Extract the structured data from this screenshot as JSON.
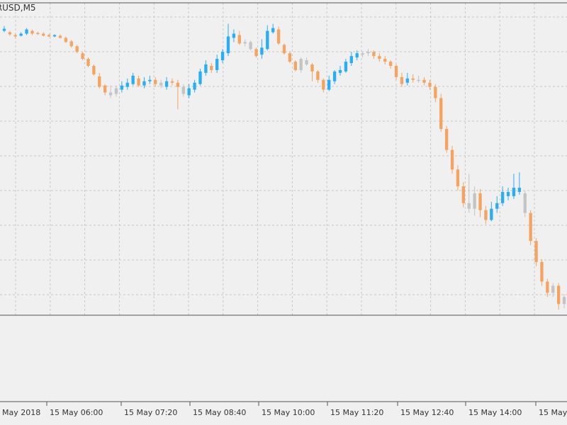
{
  "window": {
    "symbol_label": "URUSD,M5"
  },
  "colors": {
    "background": "#f0f0f0",
    "grid": "#c8c8c8",
    "axis": "#555555",
    "bull": "#29aef5",
    "bear": "#f4a460",
    "neutral": "#c4c4c4"
  },
  "chart_data": {
    "type": "candlestick",
    "title": "",
    "xlabel": "",
    "ylabel": "",
    "x_tick_labels": [
      "May 2018",
      "15 May 06:00",
      "15 May 07:20",
      "15 May 08:40",
      "15 May 10:00",
      "15 May 11:20",
      "15 May 12:40",
      "15 May 14:00",
      "15 May"
    ],
    "grid": true,
    "series": [
      {
        "values": [
          [
            40,
            37,
            33,
            42,
            "bull"
          ],
          [
            45,
            42,
            40,
            47,
            "bear"
          ],
          [
            46,
            48,
            44,
            50,
            "bear"
          ],
          [
            47,
            44,
            42,
            48,
            "bull"
          ],
          [
            44,
            38,
            36,
            46,
            "bull"
          ],
          [
            40,
            44,
            38,
            46,
            "bear"
          ],
          [
            43,
            44,
            41,
            46,
            "bear"
          ],
          [
            44,
            47,
            42,
            48,
            "bear"
          ],
          [
            46,
            48,
            44,
            49,
            "bear"
          ],
          [
            48,
            46,
            45,
            49,
            "bull"
          ],
          [
            47,
            50,
            45,
            51,
            "bear"
          ],
          [
            50,
            56,
            48,
            57,
            "bear"
          ],
          [
            55,
            62,
            53,
            64,
            "bear"
          ],
          [
            62,
            70,
            60,
            72,
            "bear"
          ],
          [
            72,
            80,
            70,
            82,
            "bear"
          ],
          [
            80,
            90,
            78,
            92,
            "bear"
          ],
          [
            90,
            102,
            88,
            104,
            "bear"
          ],
          [
            105,
            120,
            100,
            122,
            "bear"
          ],
          [
            118,
            128,
            116,
            132,
            "bear"
          ],
          [
            128,
            132,
            118,
            136,
            "neutral"
          ],
          [
            130,
            122,
            118,
            134,
            "neutral"
          ],
          [
            124,
            118,
            112,
            128,
            "bull"
          ],
          [
            120,
            114,
            108,
            124,
            "bull"
          ],
          [
            116,
            104,
            100,
            118,
            "bull"
          ],
          [
            108,
            118,
            104,
            120,
            "bear"
          ],
          [
            118,
            112,
            106,
            122,
            "bull"
          ],
          [
            112,
            110,
            104,
            116,
            "bull"
          ],
          [
            110,
            116,
            106,
            120,
            "bear"
          ],
          [
            114,
            118,
            110,
            122,
            "neutral"
          ],
          [
            120,
            112,
            106,
            124,
            "bull"
          ],
          [
            112,
            114,
            108,
            118,
            "bear"
          ],
          [
            114,
            120,
            110,
            152,
            "bear"
          ],
          [
            120,
            130,
            116,
            134,
            "neutral"
          ],
          [
            132,
            122,
            116,
            136,
            "bull"
          ],
          [
            124,
            114,
            110,
            128,
            "bull"
          ],
          [
            116,
            98,
            94,
            118,
            "bull"
          ],
          [
            100,
            88,
            82,
            104,
            "bull"
          ],
          [
            90,
            96,
            86,
            100,
            "bear"
          ],
          [
            96,
            80,
            74,
            100,
            "bull"
          ],
          [
            82,
            70,
            66,
            86,
            "bull"
          ],
          [
            72,
            48,
            30,
            76,
            "bull"
          ],
          [
            50,
            44,
            38,
            56,
            "bull"
          ],
          [
            46,
            58,
            40,
            60,
            "bear"
          ],
          [
            58,
            56,
            52,
            62,
            "neutral"
          ],
          [
            56,
            66,
            54,
            68,
            "neutral"
          ],
          [
            66,
            76,
            64,
            78,
            "bear"
          ],
          [
            74,
            64,
            52,
            80,
            "bull"
          ],
          [
            66,
            40,
            32,
            68,
            "bull"
          ],
          [
            42,
            36,
            30,
            44,
            "bull"
          ],
          [
            38,
            58,
            34,
            60,
            "bear"
          ],
          [
            60,
            72,
            58,
            74,
            "bear"
          ],
          [
            72,
            84,
            70,
            86,
            "bear"
          ],
          [
            84,
            96,
            82,
            98,
            "bear"
          ],
          [
            96,
            80,
            78,
            100,
            "neutral"
          ],
          [
            82,
            88,
            78,
            90,
            "neutral"
          ],
          [
            88,
            98,
            86,
            112,
            "bear"
          ],
          [
            98,
            110,
            96,
            114,
            "bear"
          ],
          [
            110,
            124,
            108,
            128,
            "bear"
          ],
          [
            124,
            110,
            104,
            126,
            "bull"
          ],
          [
            112,
            98,
            96,
            116,
            "bull"
          ],
          [
            100,
            96,
            90,
            104,
            "bull"
          ],
          [
            98,
            84,
            80,
            100,
            "bull"
          ],
          [
            86,
            76,
            70,
            90,
            "bull"
          ],
          [
            78,
            72,
            68,
            82,
            "bull"
          ],
          [
            74,
            72,
            70,
            78,
            "neutral"
          ],
          [
            72,
            70,
            66,
            76,
            "neutral"
          ],
          [
            70,
            76,
            68,
            80,
            "bear"
          ],
          [
            76,
            80,
            72,
            84,
            "bear"
          ],
          [
            80,
            84,
            76,
            88,
            "bear"
          ],
          [
            84,
            90,
            82,
            94,
            "bear"
          ],
          [
            90,
            106,
            88,
            110,
            "bear"
          ],
          [
            106,
            116,
            100,
            120,
            "bear"
          ],
          [
            114,
            108,
            100,
            118,
            "bull"
          ],
          [
            108,
            110,
            102,
            114,
            "bear"
          ],
          [
            110,
            110,
            104,
            114,
            "neutral"
          ],
          [
            110,
            114,
            106,
            118,
            "bear"
          ],
          [
            114,
            120,
            110,
            124,
            "bear"
          ],
          [
            120,
            136,
            116,
            142,
            "bear"
          ],
          [
            136,
            180,
            130,
            184,
            "bear"
          ],
          [
            180,
            210,
            176,
            214,
            "bear"
          ],
          [
            210,
            238,
            204,
            244,
            "bear"
          ],
          [
            238,
            262,
            232,
            268,
            "bear"
          ],
          [
            262,
            286,
            256,
            292,
            "bear"
          ],
          [
            286,
            294,
            244,
            300,
            "neutral"
          ],
          [
            294,
            272,
            262,
            304,
            "neutral"
          ],
          [
            272,
            296,
            266,
            306,
            "bear"
          ],
          [
            296,
            310,
            290,
            316,
            "bear"
          ],
          [
            310,
            294,
            284,
            312,
            "bull"
          ],
          [
            294,
            286,
            276,
            300,
            "bull"
          ],
          [
            286,
            270,
            262,
            290,
            "bull"
          ],
          [
            270,
            276,
            264,
            282,
            "bull"
          ],
          [
            276,
            264,
            244,
            280,
            "bull"
          ],
          [
            264,
            270,
            242,
            274,
            "bull"
          ],
          [
            272,
            300,
            268,
            306,
            "neutral"
          ],
          [
            300,
            340,
            296,
            346,
            "bear"
          ],
          [
            340,
            370,
            336,
            376,
            "bear"
          ],
          [
            370,
            398,
            366,
            404,
            "bear"
          ],
          [
            398,
            414,
            394,
            420,
            "bear"
          ],
          [
            414,
            404,
            400,
            420,
            "neutral"
          ],
          [
            404,
            430,
            400,
            438,
            "bear"
          ],
          [
            430,
            420,
            416,
            436,
            "neutral"
          ]
        ]
      }
    ]
  }
}
